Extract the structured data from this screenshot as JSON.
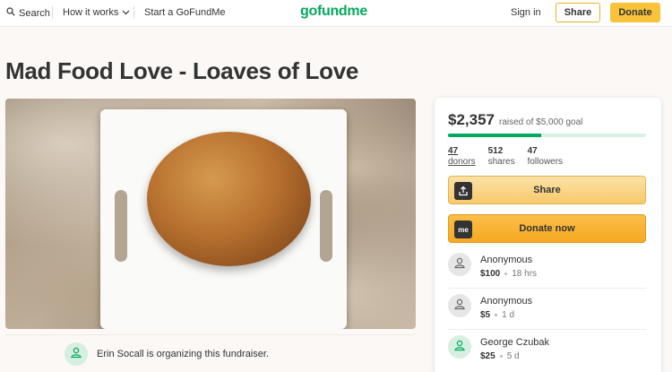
{
  "header": {
    "search_label": "Search",
    "how_label": "How it works",
    "start_label": "Start a GoFundMe",
    "logo": "gofundme",
    "signin_label": "Sign in",
    "share_label": "Share",
    "donate_label": "Donate"
  },
  "campaign": {
    "title": "Mad Food Love - Loaves of Love",
    "organizer_text": "Erin Socall is organizing this fundraiser."
  },
  "sidebar": {
    "raised_amount": "$2,357",
    "raised_goal": "raised of $5,000 goal",
    "progress_fraction": 0.4714,
    "stats": [
      {
        "num": "47",
        "label": "donors"
      },
      {
        "num": "512",
        "label": "shares"
      },
      {
        "num": "47",
        "label": "followers"
      }
    ],
    "share_button": "Share",
    "donate_button": "Donate now",
    "donate_icon_text": "me",
    "donations": [
      {
        "name": "Anonymous",
        "amount": "$100",
        "time": "18 hrs"
      },
      {
        "name": "Anonymous",
        "amount": "$5",
        "time": "1 d"
      },
      {
        "name": "George Czubak",
        "amount": "$25",
        "time": "5 d"
      }
    ]
  },
  "colors": {
    "brand_green": "#02a95c",
    "donate_yellow": "#f8c23a"
  }
}
